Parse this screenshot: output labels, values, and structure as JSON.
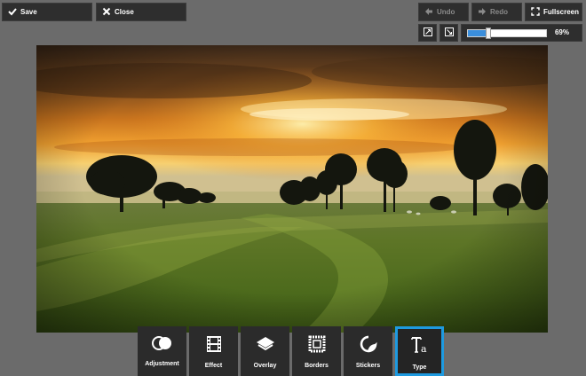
{
  "toolbar_top": {
    "save_label": "Save",
    "close_label": "Close",
    "undo_label": "Undo",
    "redo_label": "Redo",
    "fullscreen_label": "Fullscreen"
  },
  "zoom": {
    "value": 0.69,
    "label": "69%"
  },
  "colors": {
    "accent": "#1e9ae0",
    "slider_fill": "#3a8edc",
    "background": "#6b6b6b"
  },
  "tools": [
    {
      "label": "Adjustment",
      "icon": "adjustment-icon",
      "active": false
    },
    {
      "label": "Effect",
      "icon": "film-icon",
      "active": false
    },
    {
      "label": "Overlay",
      "icon": "layers-icon",
      "active": false
    },
    {
      "label": "Borders",
      "icon": "frame-icon",
      "active": false
    },
    {
      "label": "Stickers",
      "icon": "sticker-icon",
      "active": false
    },
    {
      "label": "Type",
      "icon": "type-icon",
      "active": true
    }
  ]
}
